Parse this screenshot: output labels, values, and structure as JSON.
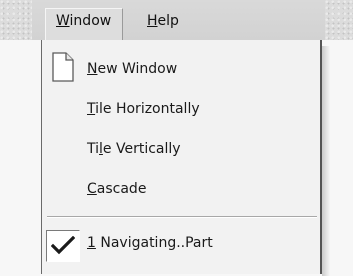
{
  "menubar": {
    "window": {
      "pre": "",
      "mnemonic": "W",
      "post": "indow"
    },
    "help": {
      "pre": "",
      "mnemonic": "H",
      "post": "elp"
    }
  },
  "window_menu": {
    "items": [
      {
        "pre": "",
        "mnemonic": "N",
        "post": "ew Window",
        "icon": "new-document-icon"
      },
      {
        "pre": "",
        "mnemonic": "T",
        "post": "ile Horizontally"
      },
      {
        "pre": "Ti",
        "mnemonic": "l",
        "post": "e Vertically"
      },
      {
        "pre": "",
        "mnemonic": "C",
        "post": "ascade"
      }
    ],
    "open_windows": [
      {
        "pre": "",
        "mnemonic": "1",
        "post": " Navigating..Part",
        "checked": true,
        "icon": "checkmark-icon"
      }
    ]
  }
}
